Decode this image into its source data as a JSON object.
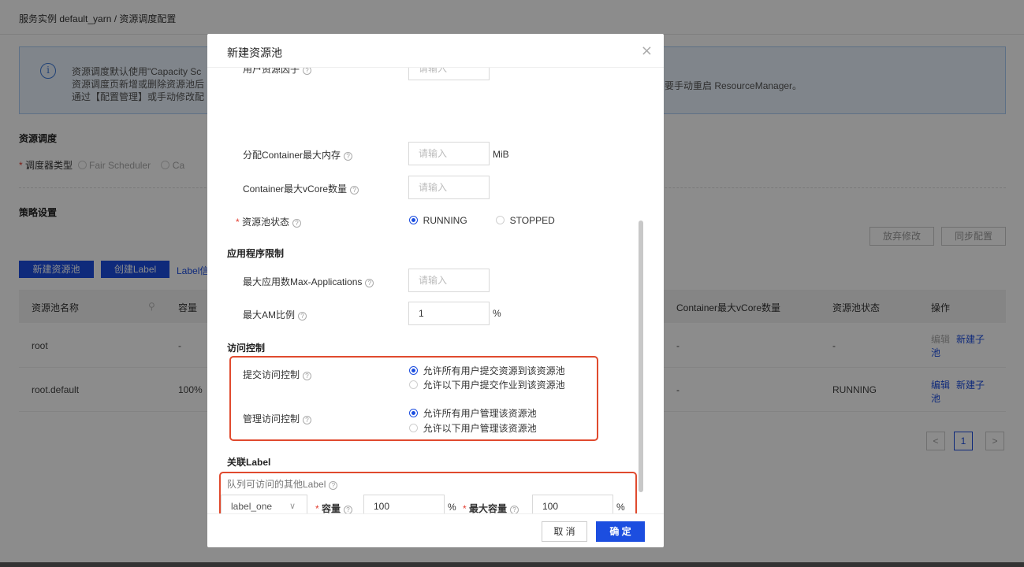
{
  "breadcrumb": "服务实例 default_yarn / 资源调度配置",
  "info": {
    "line1": "资源调度默认使用\"Capacity Sc",
    "line1_tail": "要手动重启 ResourceManager。",
    "line2": "资源调度页新增或删除资源池后",
    "line3": "通过【配置管理】或手动修改配"
  },
  "scheduling": {
    "title": "资源调度",
    "type_label": "调度器类型",
    "option_fair": "Fair Scheduler",
    "option_capacity": "Ca"
  },
  "strategy": {
    "title": "策略设置",
    "discard_button": "放弃修改",
    "sync_button": "同步配置"
  },
  "toolbar": {
    "new_pool": "新建资源池",
    "create_label": "创建Label",
    "label_info": "Label信"
  },
  "table": {
    "headers": {
      "name": "资源池名称",
      "capacity": "容量",
      "vcore": "Container最大vCore数量",
      "status": "资源池状态",
      "ops": "操作"
    },
    "rows": [
      {
        "name": "root",
        "capacity": "-",
        "vcore": "-",
        "status": "-",
        "edit": "编辑",
        "new_child": "新建子",
        "new_child2": "池"
      },
      {
        "name": "root.default",
        "capacity": "100%",
        "vcore": "-",
        "status": "RUNNING",
        "edit": "编辑",
        "new_child": "新建子",
        "new_child2": "池"
      }
    ]
  },
  "pager": {
    "prev": "<",
    "current": "1",
    "next": ">"
  },
  "modal": {
    "title": "新建资源池",
    "close": "×",
    "user_factor_label": "用户资源因子",
    "max_mem_label": "分配Container最大内存",
    "max_mem_unit": "MiB",
    "max_vcore_label": "Container最大vCore数量",
    "pool_status_label": "资源池状态",
    "status_running": "RUNNING",
    "status_stopped": "STOPPED",
    "app_limit_title": "应用程序限制",
    "max_apps_label": "最大应用数Max-Applications",
    "max_am_label": "最大AM比例",
    "max_am_value": "1",
    "max_am_unit": "%",
    "access_title": "访问控制",
    "submit_acl_label": "提交访问控制",
    "submit_all": "允许所有用户提交资源到该资源池",
    "submit_some": "允许以下用户提交作业到该资源池",
    "admin_acl_label": "管理访问控制",
    "admin_all": "允许所有用户管理该资源池",
    "admin_some": "允许以下用户管理该资源池",
    "label_title": "关联Label",
    "label_hint": "队列可访问的其他Label",
    "label_select": "label_one",
    "capacity_label": "容量",
    "capacity_value": "100",
    "capacity_unit": "%",
    "max_capacity_label": "最大容量",
    "max_capacity_value": "100",
    "max_capacity_unit": "%",
    "placeholder": "请输入",
    "cancel": "取 消",
    "ok": "确 定"
  }
}
